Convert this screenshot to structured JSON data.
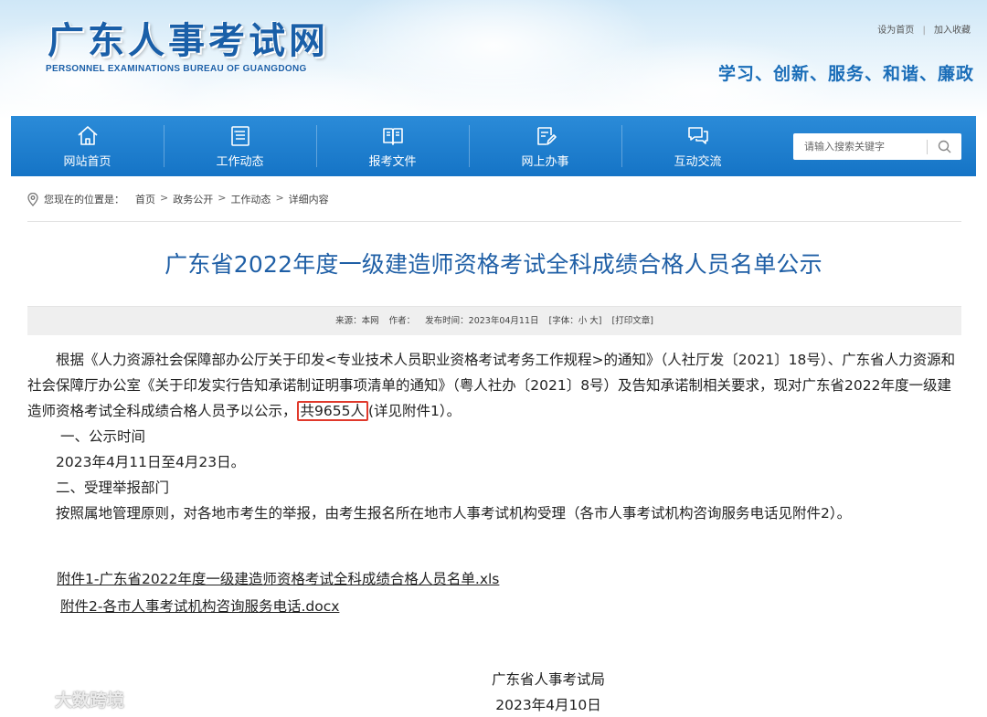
{
  "header": {
    "site_title": "广东人事考试网",
    "site_subtitle": "PERSONNEL EXAMINATIONS BUREAU OF GUANGDONG",
    "top_links": [
      "设为首页",
      "加入收藏"
    ],
    "slogan": "学习、创新、服务、和谐、廉政"
  },
  "nav": {
    "items": [
      {
        "label": "网站首页",
        "icon": "home-icon"
      },
      {
        "label": "工作动态",
        "icon": "news-icon"
      },
      {
        "label": "报考文件",
        "icon": "book-icon"
      },
      {
        "label": "网上办事",
        "icon": "edit-icon"
      },
      {
        "label": "互动交流",
        "icon": "chat-icon"
      }
    ],
    "search_placeholder": "请输入搜索关键字"
  },
  "breadcrumb": {
    "label": "您现在的位置是：",
    "items": [
      "首页",
      "政务公开",
      "工作动态",
      "详细内容"
    ]
  },
  "article": {
    "title": "广东省2022年度一级建造师资格考试全科成绩合格人员名单公示",
    "meta": {
      "source": "来源：本网",
      "author": "作者：",
      "publish_time": "发布时间：2023年04月11日",
      "font_size": "[字体：小 大]",
      "print": "[打印文章]"
    },
    "para1_a": "根据《人力资源社会保障部办公厅关于印发<专业技术人员职业资格考试考务工作规程>的通知》（人社厅发〔2021〕18号）、广东省人力资源和社会保障厅办公室《关于印发实行告知承诺制证明事项清单的通知》（粤人社办〔2021〕8号）及告知承诺制相关要求，现对广东省2022年度一级建造师资格考试全科成绩合格人员予以公示，",
    "para1_highlight": "共9655人",
    "para1_b": "(详见附件1）。",
    "section1_title": "一、公示时间",
    "section1_body": "2023年4月11日至4月23日。",
    "section2_title": "二、受理举报部门",
    "section2_body": "按照属地管理原则，对各地市考生的举报，由考生报名所在地市人事考试机构受理（各市人事考试机构咨询服务电话见附件2）。",
    "attachment1": "附件1-广东省2022年度一级建造师资格考试全科成绩合格人员名单.xls",
    "attachment2": "附件2-各市人事考试机构咨询服务电话.docx",
    "signature_org": "广东省人事考试局",
    "signature_date": "2023年4月10日"
  },
  "watermark": "大数跨境",
  "colors": {
    "nav_blue": "#1a7bcb",
    "title_blue": "#1f5fa6",
    "highlight_red": "#e0392b"
  }
}
